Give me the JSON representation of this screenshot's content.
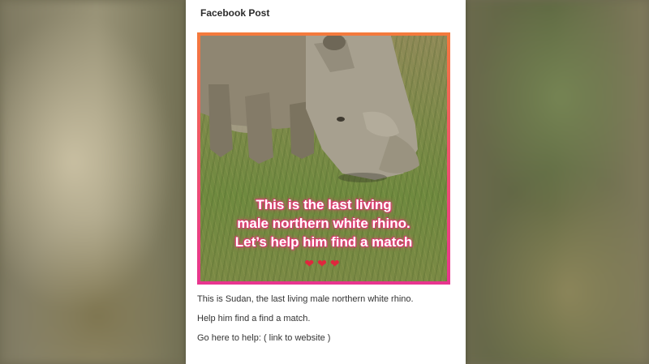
{
  "post": {
    "header": "Facebook Post",
    "image": {
      "overlay_lines": [
        "This is the last living",
        "male northern white rhino.",
        "Let’s help him find a match"
      ],
      "hearts": "❤❤❤",
      "subject_icon": "rhino-photo"
    },
    "caption_lines": [
      "This is Sudan, the last living male northern white rhino.",
      "Help him find a find a match.",
      "Go here to help:  ( link to website )"
    ]
  },
  "colors": {
    "frame_gradient_top": "#f47a3c",
    "frame_gradient_bottom": "#e8358f",
    "card_background": "#ffffff",
    "heart": "#e0263d"
  }
}
